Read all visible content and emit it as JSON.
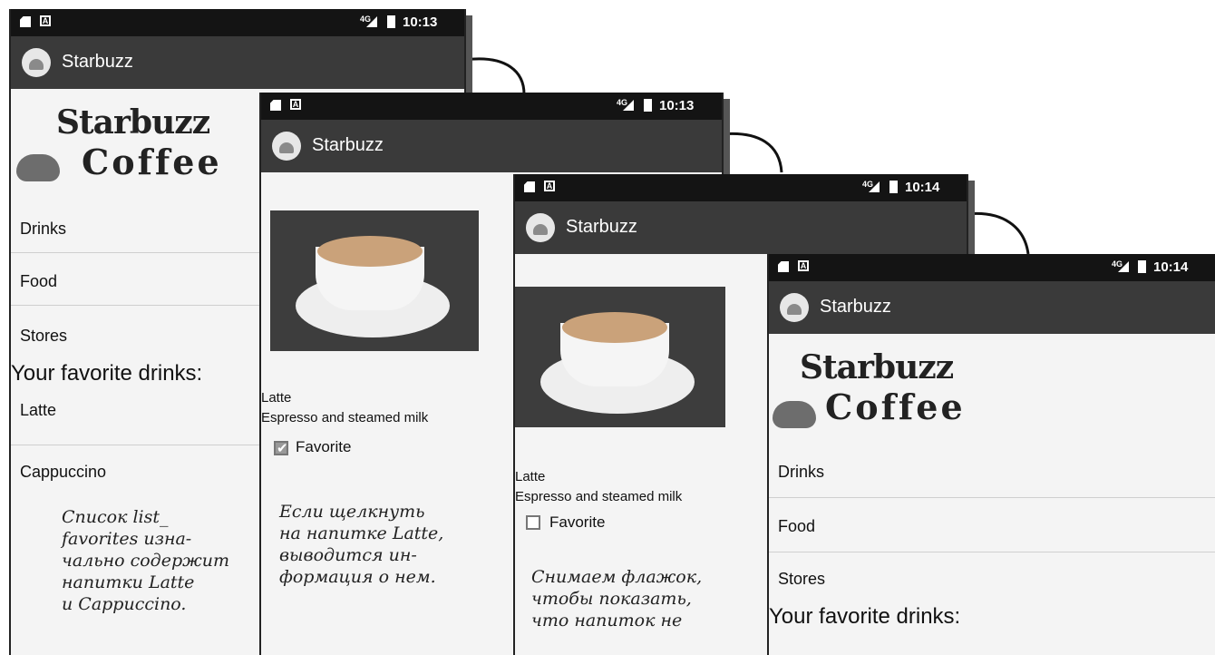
{
  "screens": [
    {
      "status": {
        "time": "10:13",
        "network": "4G"
      },
      "app_title": "Starbuzz",
      "brand": {
        "line1": "Starbuzz",
        "line2": "Coffee"
      },
      "menu": [
        "Drinks",
        "Food",
        "Stores"
      ],
      "favorites_heading": "Your favorite drinks:",
      "favorites": [
        "Latte",
        "Cappuccino"
      ]
    },
    {
      "status": {
        "time": "10:13",
        "network": "4G"
      },
      "app_title": "Starbuzz",
      "drink_name": "Latte",
      "drink_desc": "Espresso and steamed milk",
      "favorite_label": "Favorite",
      "favorite_checked": true
    },
    {
      "status": {
        "time": "10:14",
        "network": "4G"
      },
      "app_title": "Starbuzz",
      "drink_name": "Latte",
      "drink_desc": "Espresso and steamed milk",
      "favorite_label": "Favorite",
      "favorite_checked": false
    },
    {
      "status": {
        "time": "10:14",
        "network": "4G"
      },
      "app_title": "Starbuzz",
      "brand": {
        "line1": "Starbuzz",
        "line2": "Coffee"
      },
      "menu": [
        "Drinks",
        "Food",
        "Stores"
      ],
      "favorites_heading": "Your favorite drinks:"
    }
  ],
  "annotations": [
    "Список list_\nfavorites изна-\nчально содержит\nнапитки Latte\nи Cappuccino.",
    "Если щелкнуть\nна напитке Latte,\nвыводится ин-\nформация о нем.",
    "Снимаем флажок,\nчтобы показать,\nчто напиток не"
  ]
}
